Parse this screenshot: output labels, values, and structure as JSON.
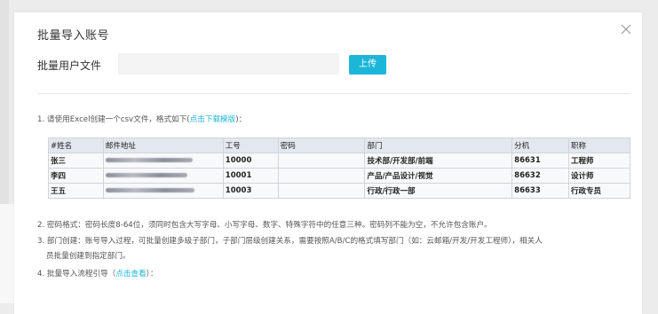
{
  "modal": {
    "title": "批量导入账号"
  },
  "upload": {
    "label": "批量用户文件",
    "input_placeholder": "",
    "button_label": "上传"
  },
  "instructions": {
    "step1_prefix": "1. 请使用Excel创建一个csv文件，格式如下(",
    "step1_link": "点击下载模版",
    "step1_suffix": ")：",
    "step2": "2. 密码格式：密码长度8-64位，须同时包含大写字母、小写字母、数字、特殊字符中的任意三种。密码列不能为空，不允许包含账户。",
    "step3_line1": "3. 部门创建：账号导入过程，可批量创建多级子部门，子部门层级创建关系，需要按照A/B/C的格式填写部门（如：云邮箱/开发/开发工程师），相关人",
    "step3_line2": "员批量创建到指定部门。",
    "step4_prefix": "4. 批量导入流程引导（",
    "step4_link": "点击查看",
    "step4_suffix": "）："
  },
  "sample_table": {
    "headers": [
      "#姓名",
      "邮件地址",
      "工号",
      "密码",
      "部门",
      "分机",
      "职称"
    ],
    "rows": [
      {
        "name": "张三",
        "id": "10000",
        "password": "",
        "dept": "技术部/开发部/前端",
        "ext": "86631",
        "title": "工程师"
      },
      {
        "name": "李四",
        "id": "10001",
        "password": "",
        "dept": "产品/产品设计/视觉",
        "ext": "86632",
        "title": "设计师"
      },
      {
        "name": "王五",
        "id": "10003",
        "password": "",
        "dept": "行政/行政一部",
        "ext": "86633",
        "title": "行政专员"
      }
    ]
  },
  "colors": {
    "accent": "#1cb6d8",
    "table_header_bg": "#e3e7ee"
  }
}
